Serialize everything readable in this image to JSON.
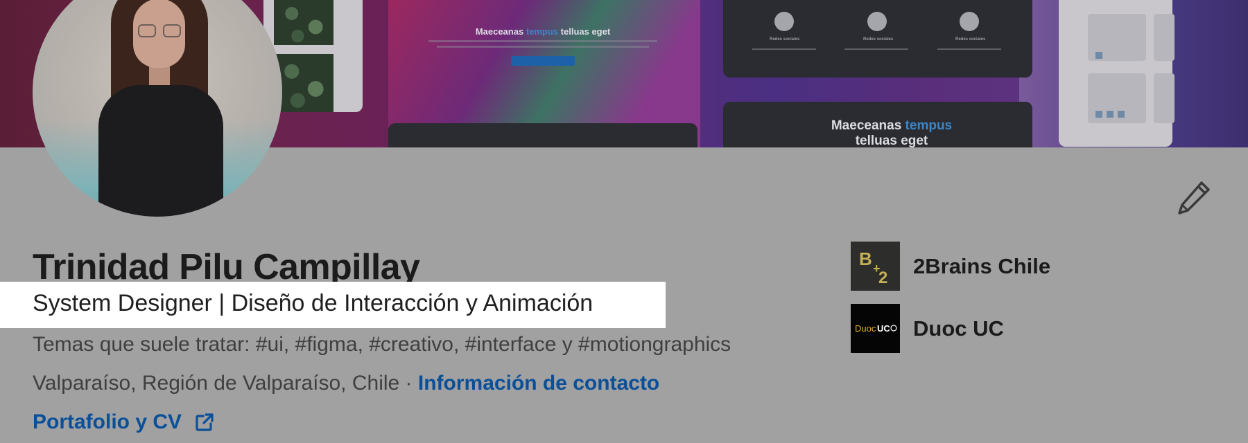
{
  "banner": {
    "hero_title_a": "Maeceanas ",
    "hero_title_accent": "tempus",
    "hero_title_b": " telluas eget",
    "column_titles": [
      "Redes sociales",
      "Redes sociales",
      "Redes sociales"
    ],
    "card_title_a": "Maeceanas ",
    "card_title_accent": "tempus",
    "card_title_b": "telluas eget"
  },
  "profile": {
    "name": "Trinidad Pilu Campillay",
    "headline": "System Designer | Diseño de Interacción y Animación",
    "topics": "Temas que suele tratar: #ui, #figma, #creativo, #interface y #motiongraphics",
    "location": "Valparaíso, Región de Valparaíso, Chile",
    "separator": " · ",
    "contact_link": "Información de contacto",
    "portfolio_link": "Portafolio y CV"
  },
  "companies": [
    {
      "name": "2Brains Chile",
      "logo_text": "B+2"
    },
    {
      "name": "Duoc UC",
      "logo_text": "DuocUC"
    }
  ],
  "icons": {
    "edit": "pencil-icon",
    "external": "external-link-icon"
  },
  "colors": {
    "page_overlay": "#a1a1a1",
    "link": "#0a4f98",
    "headline_highlight": "#ffffff",
    "brains_logo_gold": "#c4b15a"
  }
}
